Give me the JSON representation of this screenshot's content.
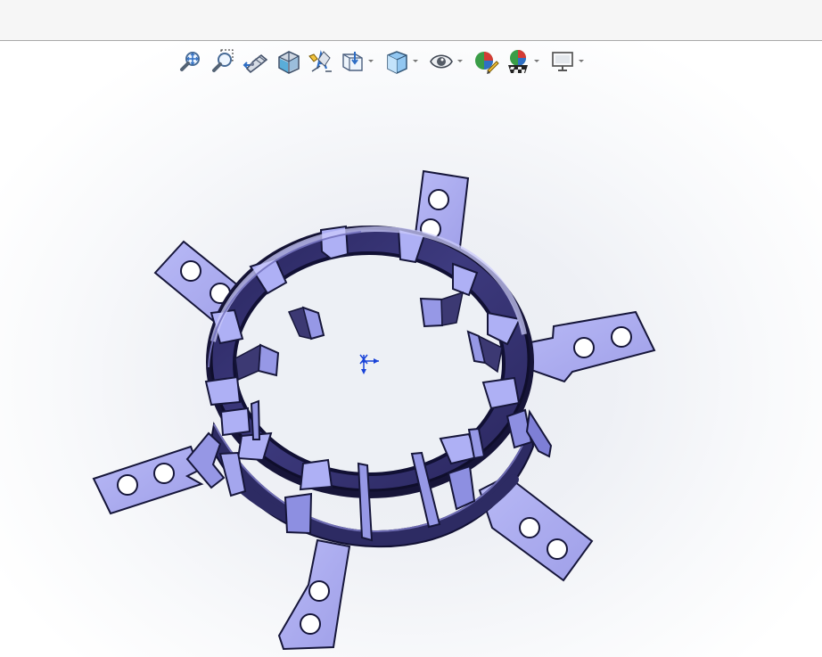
{
  "window": {
    "top_bar": ""
  },
  "heads_up_toolbar": {
    "tools": [
      {
        "name": "zoom-to-fit",
        "icon": "zoom-to-fit-icon"
      },
      {
        "name": "zoom-to-area",
        "icon": "zoom-to-area-icon"
      },
      {
        "name": "previous-view",
        "icon": "previous-view-icon"
      },
      {
        "name": "section-view",
        "icon": "section-view-icon"
      },
      {
        "name": "dynamic-annotation-views",
        "icon": "dynamic-annotation-icon"
      },
      {
        "name": "view-orientation",
        "icon": "view-orientation-icon",
        "has_dropdown": true
      },
      {
        "name": "display-style",
        "icon": "display-style-icon",
        "has_dropdown": true
      },
      {
        "name": "hide-show-items",
        "icon": "eye-icon",
        "has_dropdown": true
      },
      {
        "name": "edit-appearance",
        "icon": "edit-appearance-icon"
      },
      {
        "name": "apply-scene",
        "icon": "apply-scene-icon",
        "has_dropdown": true
      },
      {
        "name": "view-settings",
        "icon": "monitor-icon",
        "has_dropdown": true
      }
    ]
  },
  "model": {
    "name": "sheet-metal-ring-part",
    "colors": {
      "face": "#a7a8ee",
      "face_light": "#c1c2f7",
      "shadow": "#2d2b63",
      "outline": "#16163a",
      "hole": "#ffffff"
    }
  },
  "viewport": {
    "background_center": "#e9ecf2",
    "background_edge": "#ffffff"
  }
}
